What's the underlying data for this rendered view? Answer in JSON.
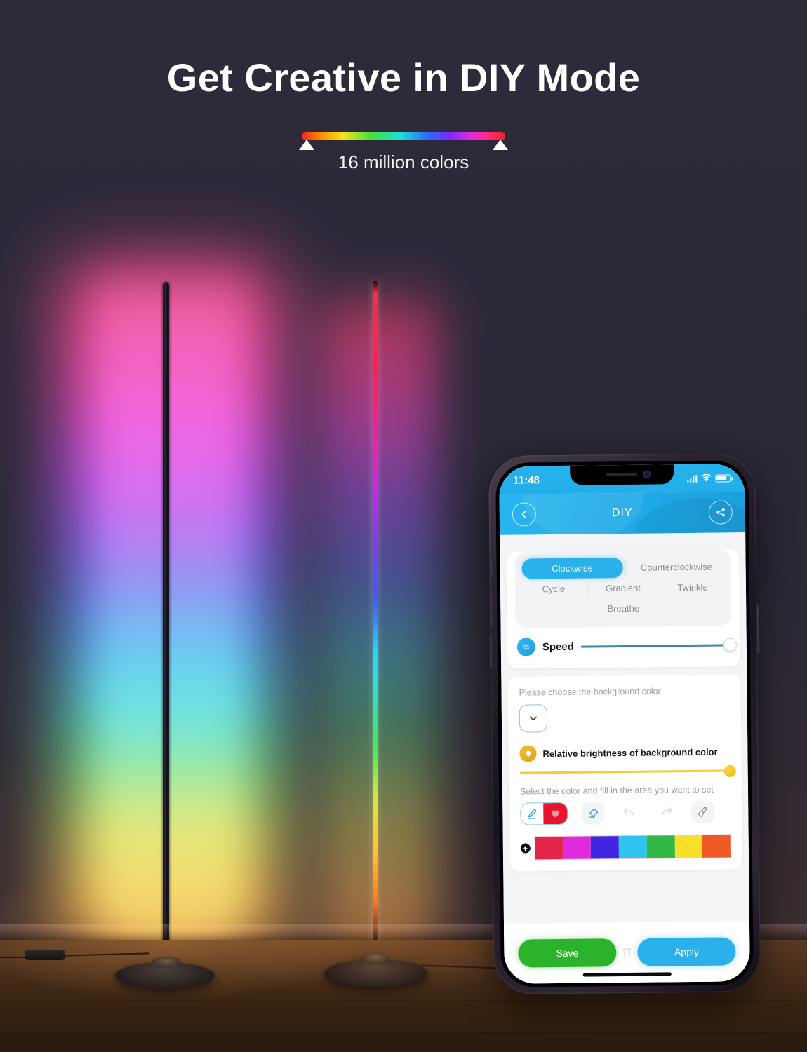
{
  "hero": {
    "headline": "Get Creative in DIY Mode",
    "color_bar_caption": "16 million colors",
    "gradient_stops": [
      "#ff1f1f",
      "#ff8a00",
      "#f7e31c",
      "#3fe03f",
      "#1fe0d2",
      "#2b6bff",
      "#7a2bff",
      "#e62bd8",
      "#ff1f1f"
    ],
    "background_color": "#2c2939"
  },
  "scene": {
    "lamp_left_name": "rgb-corner-floor-lamp-left",
    "lamp_right_name": "rgb-corner-floor-lamp-right",
    "lamp_gradient": [
      "#ff2a4a",
      "#f21fa5",
      "#d224e8",
      "#7a3cf0",
      "#3f5cf2",
      "#28d8f5",
      "#46e85c",
      "#d8e83c",
      "#ffc32a",
      "#ff7a25"
    ]
  },
  "phone": {
    "status_bar": {
      "time": "11:48",
      "signal_icon": "cellular-signal-icon",
      "wifi_icon": "wifi-icon",
      "battery_icon": "battery-icon"
    },
    "nav": {
      "back_icon": "chevron-left-icon",
      "title": "DIY",
      "share_icon": "share-icon"
    },
    "modes": {
      "items": [
        {
          "label": "Clockwise",
          "active": true
        },
        {
          "label": "Counterclockwise",
          "active": false
        },
        {
          "label": "Cycle",
          "active": false
        },
        {
          "label": "Gradient",
          "active": false
        },
        {
          "label": "Twinkle",
          "active": false
        },
        {
          "label": "Breathe",
          "active": false
        }
      ],
      "active_color": "#2ab0ea"
    },
    "speed": {
      "icon": "speed-icon",
      "label": "Speed",
      "value": 100,
      "track_color": "#3f86ab"
    },
    "background_color_section": {
      "hint": "Please choose the background color",
      "picker_icon": "chevron-down-icon"
    },
    "brightness_section": {
      "icon": "bulb-icon",
      "label": "Relative brightness of background color",
      "value": 100,
      "track_color": "#f2cd3a"
    },
    "draw_section": {
      "hint": "Select the color and fill in the area you want to set",
      "tools": [
        {
          "name": "pen-tool",
          "active": true,
          "swatch": "#e8142e"
        },
        {
          "name": "eraser-tool",
          "active": false
        },
        {
          "name": "undo-tool",
          "active": false
        },
        {
          "name": "redo-tool",
          "active": false
        },
        {
          "name": "clear-brush-tool",
          "active": false
        }
      ],
      "palette_toggle_icon": "lightning-bolt-icon",
      "palette": [
        "#e3264c",
        "#e02ae0",
        "#4026e0",
        "#2ec4f0",
        "#34b845",
        "#f7df2a",
        "#f05a24"
      ]
    },
    "actions": {
      "save_label": "Save",
      "apply_label": "Apply",
      "delete_icon": "trash-icon"
    }
  }
}
